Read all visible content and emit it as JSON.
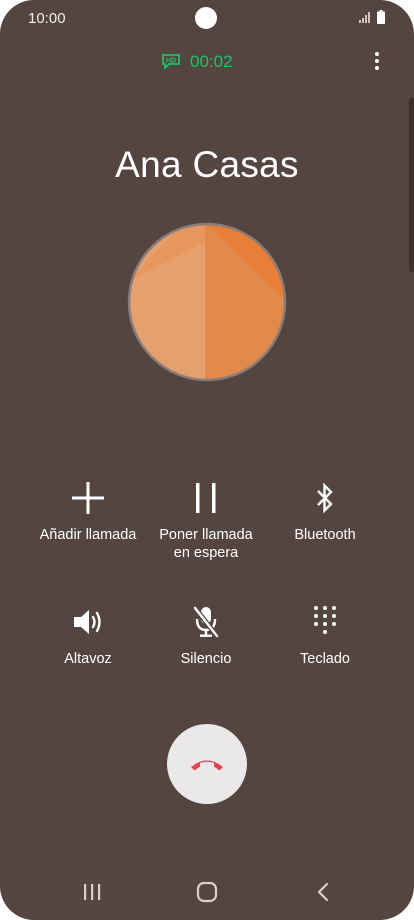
{
  "status_bar": {
    "time": "10:00",
    "icons": [
      "signal-icon",
      "battery-icon"
    ]
  },
  "call": {
    "hd_badge": "HD",
    "timer": "00:02",
    "contact_name": "Ana Casas",
    "menu_icon": "more-vert-icon"
  },
  "actions": [
    {
      "icon": "plus-icon",
      "label": "Añadir llamada"
    },
    {
      "icon": "pause-icon",
      "label": "Poner llamada\nen espera"
    },
    {
      "icon": "bluetooth-icon",
      "label": "Bluetooth"
    },
    {
      "icon": "speaker-icon",
      "label": "Altavoz"
    },
    {
      "icon": "mute-mic-icon",
      "label": "Silencio"
    },
    {
      "icon": "keypad-icon",
      "label": "Teclado"
    }
  ],
  "end_call": {
    "icon": "end-call-icon",
    "color": "#e8424f"
  },
  "nav": {
    "icons": [
      "recent-apps-icon",
      "home-icon",
      "back-icon"
    ]
  },
  "colors": {
    "background": "#554540",
    "timer": "#20c06a",
    "avatar": "#e38a4e",
    "end_call_button": "#ebe8e9"
  }
}
